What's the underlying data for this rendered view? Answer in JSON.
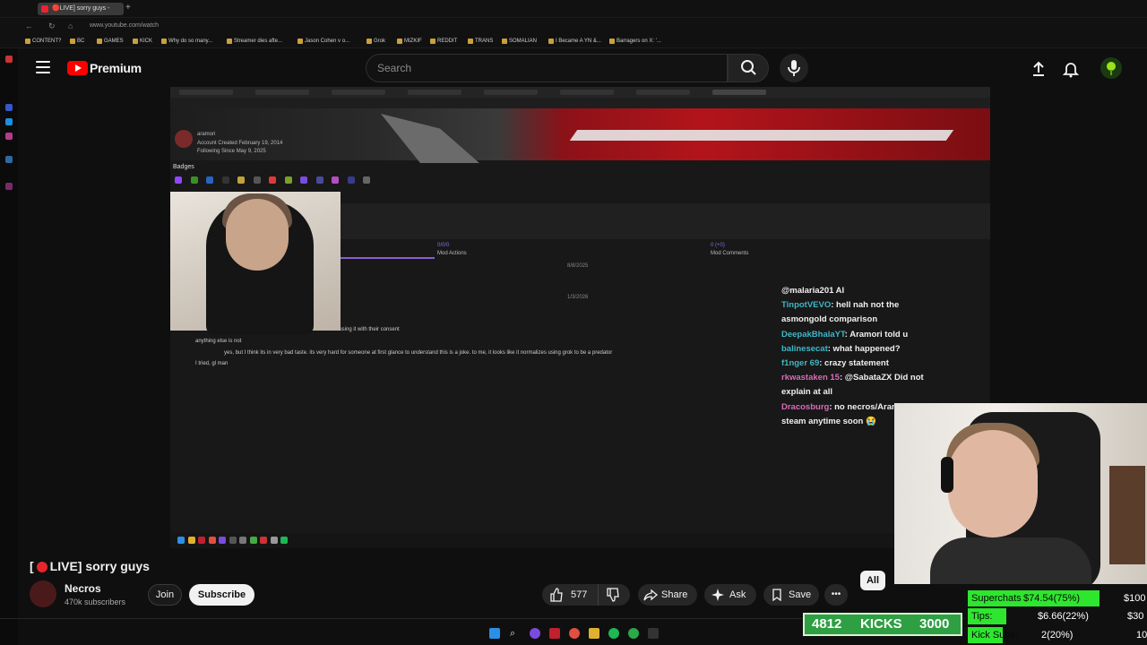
{
  "browser": {
    "tab_title": "🔴LIVE] sorry guys -",
    "url": "www.youtube.com/watch",
    "bookmarks": [
      "CONTENT?",
      "BC",
      "GAMES",
      "KICK",
      "Why do so many...",
      "Streamer dies afte...",
      "Jason Cohen v o...",
      "Grok",
      "MIZKIF",
      "REDDIT",
      "TRANS",
      "SOMALIAN",
      "I Became A YN &...",
      "Barragers on X: '..."
    ]
  },
  "header": {
    "logo_text": "Premium",
    "search_placeholder": "Search"
  },
  "video_content": {
    "profile_line1": "aramori",
    "profile_line2": "Account Created February 19, 2014",
    "profile_line3": "Following Since May 9, 2025",
    "badges_label": "Badges",
    "mod_actions_count": "0/0/0",
    "mod_actions_label": "Mod Actions",
    "mod_comments_count": "0 (+0)",
    "mod_comments_label": "Mod Comments",
    "date1": "8/8/2025",
    "date2": "1/3/2026",
    "log_line0": "en using it with their consent",
    "log_line1": "anything else is not",
    "log_line2": "yes, but I think its in very bad taste. its very hard for someone at first glance to understand this is a joke. to me, it looks like it normalizes using grok to be a predator",
    "log_line3": "I tried, gl man"
  },
  "chat_overlay": [
    {
      "user": "",
      "text": "@malaria201 AI"
    },
    {
      "user": "TinpotVEVO",
      "text": ": hell nah not the"
    },
    {
      "user": "",
      "text": "asmongold comparison"
    },
    {
      "user": "DeepakBhalaYT",
      "text": ": Aramori told u"
    },
    {
      "user": "balinesecat",
      "text": ": what happened?"
    },
    {
      "user": "f1nger 69",
      "text": ": crazy statement"
    },
    {
      "user": "rkwastaken 15",
      "text": ": @SabataZX Did not"
    },
    {
      "user": "",
      "text": "explain at all"
    },
    {
      "user": "Dracosburg",
      "text": ": no necros/Aramori co"
    },
    {
      "user": "",
      "text": "steam anytime soon 😭"
    }
  ],
  "video_info": {
    "title_prefix": "[",
    "title_suffix": "LIVE] sorry guys",
    "channel": "Necros",
    "subscribers": "470k subscribers",
    "join_label": "Join",
    "subscribe_label": "Subscribe",
    "likes": "577",
    "share_label": "Share",
    "ask_label": "Ask",
    "save_label": "Save",
    "more_label": "•••",
    "chip_all": "All"
  },
  "goals": {
    "kicks_current": "4812",
    "kicks_label": "KICKS",
    "kicks_goal": "3000",
    "superchats_label": "Superchats",
    "superchats_value": "$74.54(75%)",
    "superchats_goal": "$100",
    "superchats_fraction": 0.75,
    "tips_label": "Tips:",
    "tips_value": "$6.66(22%)",
    "tips_goal": "$30",
    "tips_fraction": 0.22,
    "kicksubs_label": "Kick Subs:",
    "kicksubs_value": "2(20%)",
    "kicksubs_goal": "10",
    "kicksubs_fraction": 0.2
  },
  "colors": {
    "youtube_red": "#ff0000",
    "goal_green": "#2ee62e",
    "kicks_green": "#2ea043",
    "chat_user": "#3fb7c7"
  }
}
